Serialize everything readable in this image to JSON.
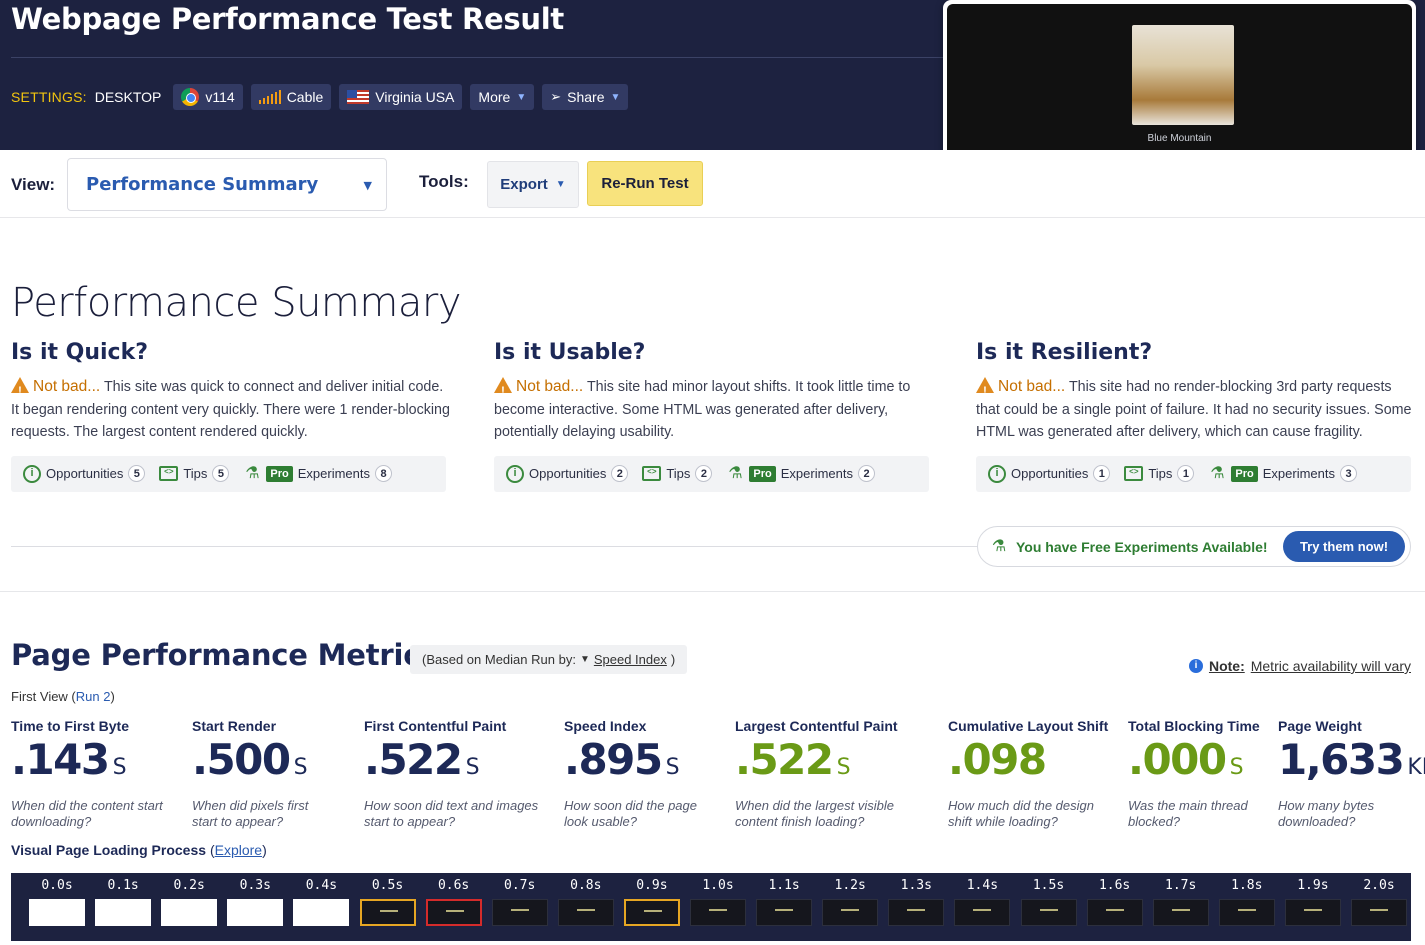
{
  "header": {
    "title": "Webpage Performance Test Result",
    "settings_label": "SETTINGS:",
    "settings_value": "DESKTOP",
    "pills": {
      "browser": "v114",
      "connection": "Cable",
      "location": "Virginia USA",
      "more": "More",
      "share": "Share"
    }
  },
  "video": {
    "caption": "Blue Mountain"
  },
  "toolbar": {
    "view_label": "View:",
    "view_selected": "Performance Summary",
    "tools_label": "Tools:",
    "export_label": "Export",
    "rerun_label": "Re-Run Test"
  },
  "summary": {
    "title": "Performance Summary",
    "columns": [
      {
        "heading": "Is it Quick?",
        "verdict": "Not bad...",
        "text": "This site was quick to connect and deliver initial code. It began rendering content very quickly. There were 1 render-blocking requests. The largest content rendered quickly.",
        "opportunities_label": "Opportunities",
        "opportunities": "5",
        "tips_label": "Tips",
        "tips": "5",
        "pro_label": "Pro",
        "experiments_label": "Experiments",
        "experiments": "8"
      },
      {
        "heading": "Is it Usable?",
        "verdict": "Not bad...",
        "text": "This site had minor layout shifts. It took little time to become interactive. Some HTML was generated after delivery, potentially delaying usability.",
        "opportunities_label": "Opportunities",
        "opportunities": "2",
        "tips_label": "Tips",
        "tips": "2",
        "pro_label": "Pro",
        "experiments_label": "Experiments",
        "experiments": "2"
      },
      {
        "heading": "Is it Resilient?",
        "verdict": "Not bad...",
        "text": "This site had no render-blocking 3rd party requests that could be a single point of failure. It had no security issues. Some HTML was generated after delivery, which can cause fragility.",
        "opportunities_label": "Opportunities",
        "opportunities": "1",
        "tips_label": "Tips",
        "tips": "1",
        "pro_label": "Pro",
        "experiments_label": "Experiments",
        "experiments": "3"
      }
    ],
    "free_experiments_text": "You have Free Experiments Available!",
    "try_button": "Try them now!"
  },
  "metrics_section": {
    "title": "Page Performance Metrics",
    "median_prefix": "(Based on Median Run by:",
    "median_link": "Speed Index",
    "median_suffix": ")",
    "note_bold": "Note:",
    "note_text": "Metric availability will vary",
    "first_view": "First View (",
    "run_link": "Run 2",
    "first_view_end": ")",
    "metrics": [
      {
        "label": "Time to First Byte",
        "value": ".143",
        "unit": "S",
        "desc": "When did the content start downloading?",
        "status": "neutral"
      },
      {
        "label": "Start Render",
        "value": ".500",
        "unit": "S",
        "desc": "When did pixels first start to appear?",
        "status": "neutral"
      },
      {
        "label": "First Contentful Paint",
        "value": ".522",
        "unit": "S",
        "desc": "How soon did text and images start to appear?",
        "status": "neutral"
      },
      {
        "label": "Speed Index",
        "value": ".895",
        "unit": "S",
        "desc": "How soon did the page look usable?",
        "status": "neutral"
      },
      {
        "label": "Largest Contentful Paint",
        "value": ".522",
        "unit": "S",
        "desc": "When did the largest visible content finish loading?",
        "status": "good"
      },
      {
        "label": "Cumulative Layout Shift",
        "value": ".098",
        "unit": "",
        "desc": "How much did the design shift while loading?",
        "status": "good"
      },
      {
        "label": "Total Blocking Time",
        "value": ".000",
        "unit": "S",
        "desc": "Was the main thread blocked?",
        "status": "good"
      },
      {
        "label": "Page Weight",
        "value": "1,633",
        "unit": "KB",
        "desc": "How many bytes downloaded?",
        "status": "neutral"
      }
    ],
    "visual_label": "Visual Page Loading Process",
    "explore_prefix": "(",
    "explore_link": "Explore",
    "explore_suffix": ")",
    "filmstrip": [
      "0.0s",
      "0.1s",
      "0.2s",
      "0.3s",
      "0.4s",
      "0.5s",
      "0.6s",
      "0.7s",
      "0.8s",
      "0.9s",
      "1.0s",
      "1.1s",
      "1.2s",
      "1.3s",
      "1.4s",
      "1.5s",
      "1.6s",
      "1.7s",
      "1.8s",
      "1.9s",
      "2.0s"
    ]
  },
  "colors": {
    "header_bg": "#1d2240",
    "accent_blue": "#2a5bb0",
    "rerun_yellow": "#f8e37d",
    "good_green": "#6a9a16",
    "warning_orange": "#c56f00"
  }
}
